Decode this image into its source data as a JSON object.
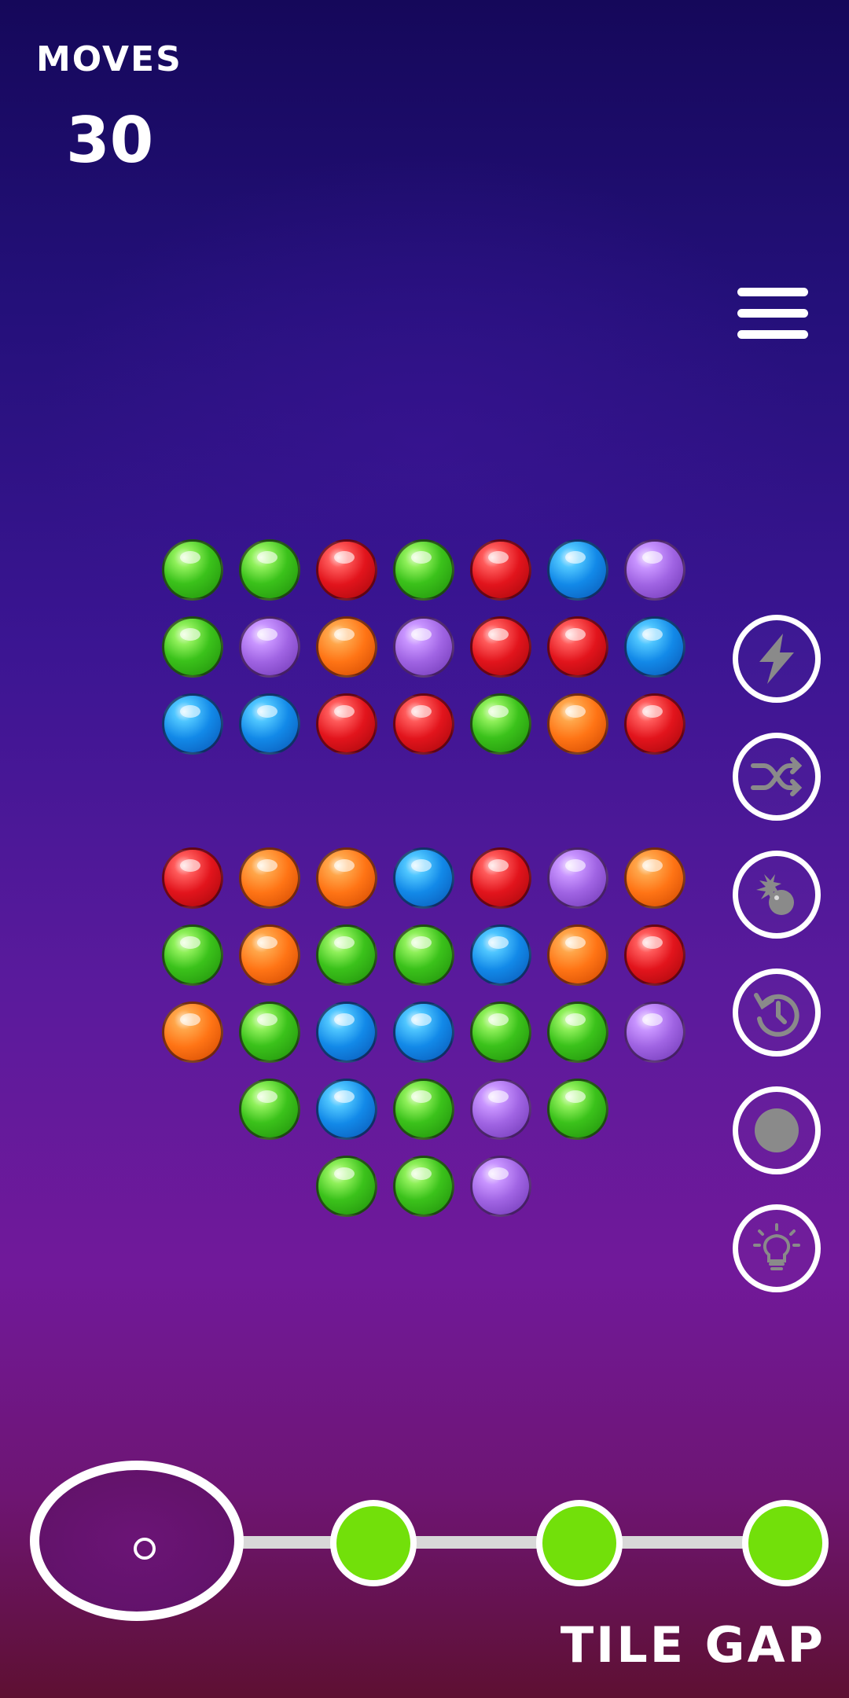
{
  "hud": {
    "moves_label": "MOVES",
    "moves_value": "30"
  },
  "menu": {
    "icon": "hamburger-menu-icon"
  },
  "board": {
    "colors": {
      "green": "#3bc21b",
      "red": "#e2141c",
      "blue": "#1289e8",
      "purple": "#a064e3",
      "orange": "#ff7415"
    },
    "rows": [
      [
        "green",
        "green",
        "red",
        "green",
        "red",
        "blue",
        "purple"
      ],
      [
        "green",
        "purple",
        "orange",
        "purple",
        "red",
        "red",
        "blue"
      ],
      [
        "blue",
        "blue",
        "red",
        "red",
        "green",
        "orange",
        "red"
      ],
      [],
      [
        "red",
        "orange",
        "orange",
        "blue",
        "red",
        "purple",
        "orange"
      ],
      [
        "green",
        "orange",
        "green",
        "green",
        "blue",
        "orange",
        "red"
      ],
      [
        "orange",
        "green",
        "blue",
        "blue",
        "green",
        "green",
        "purple"
      ],
      [
        null,
        "green",
        "blue",
        "green",
        "purple",
        "green",
        null
      ],
      [
        null,
        null,
        "green",
        "green",
        "purple",
        null,
        null
      ]
    ]
  },
  "powerups": [
    {
      "name": "lightning-icon"
    },
    {
      "name": "shuffle-icon"
    },
    {
      "name": "bomb-icon"
    },
    {
      "name": "undo-icon"
    },
    {
      "name": "ball-icon"
    },
    {
      "name": "lightbulb-icon"
    }
  ],
  "progress": {
    "nodes_filled": 3,
    "accent": "#72e00a"
  },
  "footer": {
    "label": "TILE GAP"
  }
}
